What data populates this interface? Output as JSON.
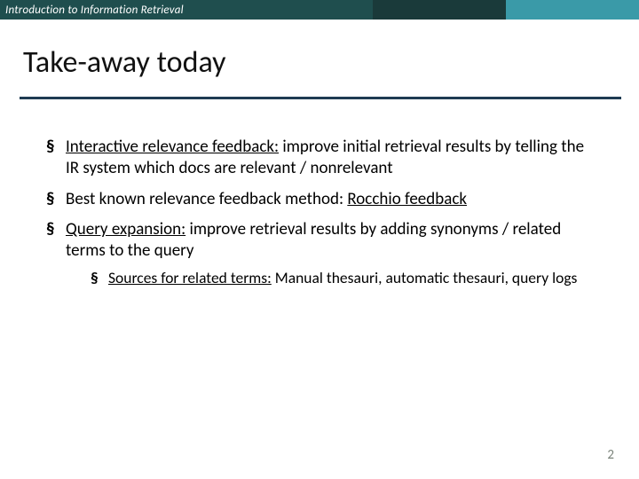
{
  "header": {
    "course": "Introduction to Information Retrieval"
  },
  "title": "Take-away today",
  "bullets": [
    {
      "lead": "Interactive relevance feedback:",
      "rest": " improve initial retrieval results by telling the IR system which docs are relevant / nonrelevant"
    },
    {
      "pre": "Best known relevance feedback method: ",
      "lead": "Rocchio feedback",
      "rest": ""
    },
    {
      "lead": "Query expansion:",
      "rest": " improve retrieval results by adding synonyms / related terms to the query"
    }
  ],
  "sub": [
    {
      "lead": "Sources for related terms:",
      "rest": " Manual thesauri, automatic thesauri, query logs"
    }
  ],
  "page_number": "2"
}
